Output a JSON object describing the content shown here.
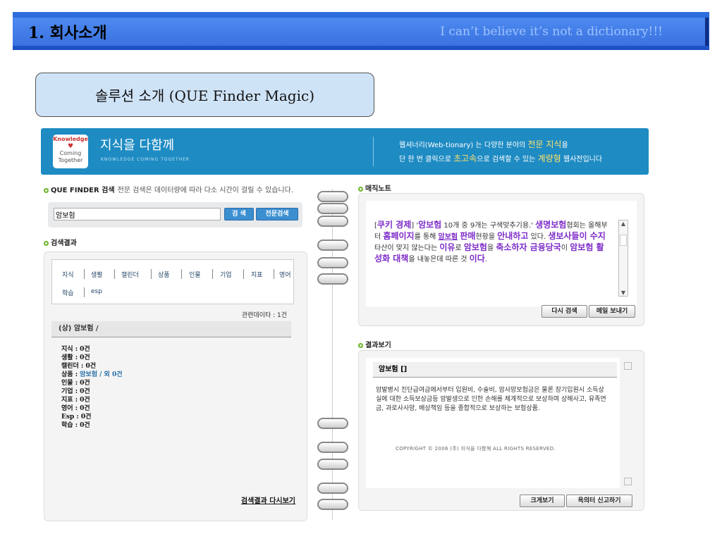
{
  "slide": {
    "title": "1. 회사소개",
    "subtitle": "I can’t believe it’s not a dictionary!!!",
    "section": "솔루션 소개 (QUE Finder Magic)"
  },
  "banner": {
    "logo_lines": [
      "Knowledge",
      "Coming",
      "Together"
    ],
    "brand_ko": "지식을 다함께",
    "brand_en": "KNOWLEDGE COMING TOGETHER",
    "line1_a": "웹셔너리(Web-tionary) 는 다양한 분야의 ",
    "line1_b": "전문 지식",
    "line1_c": "을",
    "line2_a": "단 한 번 클릭으로 ",
    "line2_b": "초고속",
    "line2_c": "으로 검색할 수 있는 ",
    "line2_d": "계량형",
    "line2_e": " 웹사전입니다"
  },
  "search": {
    "label": "QUE FINDER 검색",
    "note": "전문 검색은 데이터량에 따라 다소 시간이 걸릴 수 있습니다.",
    "value": "암보험",
    "search_btn": "검 색",
    "expert_btn": "전문검색"
  },
  "results": {
    "label": "검색결과",
    "tabs_row1": [
      "지식",
      "생활",
      "캘린더",
      "상품",
      "인물",
      "기업",
      "지표",
      "영어"
    ],
    "tabs_row2": [
      "학습",
      "esp"
    ],
    "meta": "관련데이타 : 1건",
    "head": "(상) 암보험 /",
    "counts": [
      {
        "k": "지식",
        "v": "0건"
      },
      {
        "k": "생활",
        "v": "0건"
      },
      {
        "k": "캘린더",
        "v": "0건"
      },
      {
        "k": "상품",
        "v": "암보험 / 외 0건"
      },
      {
        "k": "인물",
        "v": "0건"
      },
      {
        "k": "기업",
        "v": "0건"
      },
      {
        "k": "지표",
        "v": "0건"
      },
      {
        "k": "영어",
        "v": "0건"
      },
      {
        "k": "Esp",
        "v": "0건"
      },
      {
        "k": "학습",
        "v": "0건"
      }
    ],
    "again": "검색결과 다시보기"
  },
  "notes": {
    "label": "매직노트",
    "t1": "[",
    "t2": "쿠키 경제",
    "t3": "] '",
    "t4": "암보험",
    "t5": " 10개 중 9개는 구색맞추기용.' ",
    "t6": "생명보험",
    "t7": "협회는 올해부터 ",
    "t8": "홈페이지",
    "t9": "를 통해 ",
    "t10": "암보험",
    "t11": " ",
    "t12": "판매",
    "t13": "현황을 ",
    "t14": "안내하고",
    "t15": " 있다. ",
    "t16": "생보사들이 수지",
    "t17": "타산이 맞지 않는다는 ",
    "t18": "이유",
    "t19": "로 ",
    "t20": "암보험",
    "t21": "을 ",
    "t22": "축소하자 금융당국",
    "t23": "이 ",
    "t24": "암보험 활성화 대책",
    "t25": "을 내놓은데 따른 것",
    "t26": "이다",
    "t27": ".",
    "btn_retry": "다시 검색",
    "btn_mail": "메일 보내기"
  },
  "view": {
    "label": "결과보기",
    "head": "암보험 []",
    "desc": "암발병시 진단급여금에서부터 입원비, 수술비, 암사망보험금은 물론 장기입원시 소득상실에 대한 소득보상금등 암발생으로 인한 손해를 체계적으로 보상하며 상해사고, 유족연금, 과로사사망, 배상책임 등을 종합적으로 보상하는 보험상품.",
    "copyright": "COPYRIGHT © 2006 (주) 지식을 다함께 ALL RIGHTS RESERVED.",
    "btn_large": "크게보기",
    "btn_report": "욕의터 신고하기"
  }
}
